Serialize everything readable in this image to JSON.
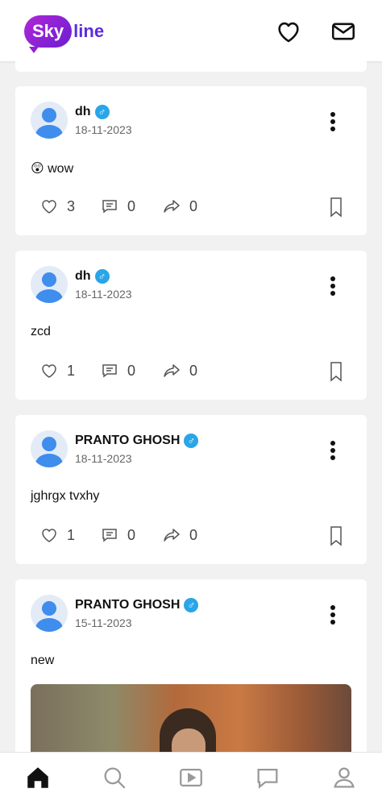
{
  "header": {
    "logo_part1": "Sky",
    "logo_part2": "line",
    "icons": [
      "heart-icon",
      "mail-icon"
    ]
  },
  "posts": [
    {
      "author": "dh",
      "gender_symbol": "♂",
      "date": "18-11-2023",
      "content": "😲 wow",
      "likes": "3",
      "comments": "0",
      "shares": "0"
    },
    {
      "author": "dh",
      "gender_symbol": "♂",
      "date": "18-11-2023",
      "content": "zcd",
      "likes": "1",
      "comments": "0",
      "shares": "0"
    },
    {
      "author": "PRANTO GHOSH",
      "gender_symbol": "♂",
      "date": "18-11-2023",
      "content": "jghrgx tvxhy",
      "likes": "1",
      "comments": "0",
      "shares": "0"
    },
    {
      "author": "PRANTO GHOSH",
      "gender_symbol": "♂",
      "date": "15-11-2023",
      "content": "new"
    }
  ],
  "bottom_nav": {
    "items": [
      "home-icon",
      "search-icon",
      "video-icon",
      "chat-icon",
      "profile-icon"
    ],
    "active": "home-icon"
  },
  "colors": {
    "brand_gradient_start": "#b026d8",
    "brand_gradient_end": "#6a1fd0",
    "avatar_blue": "#3f8ded",
    "verified_blue": "#29a5e8"
  }
}
